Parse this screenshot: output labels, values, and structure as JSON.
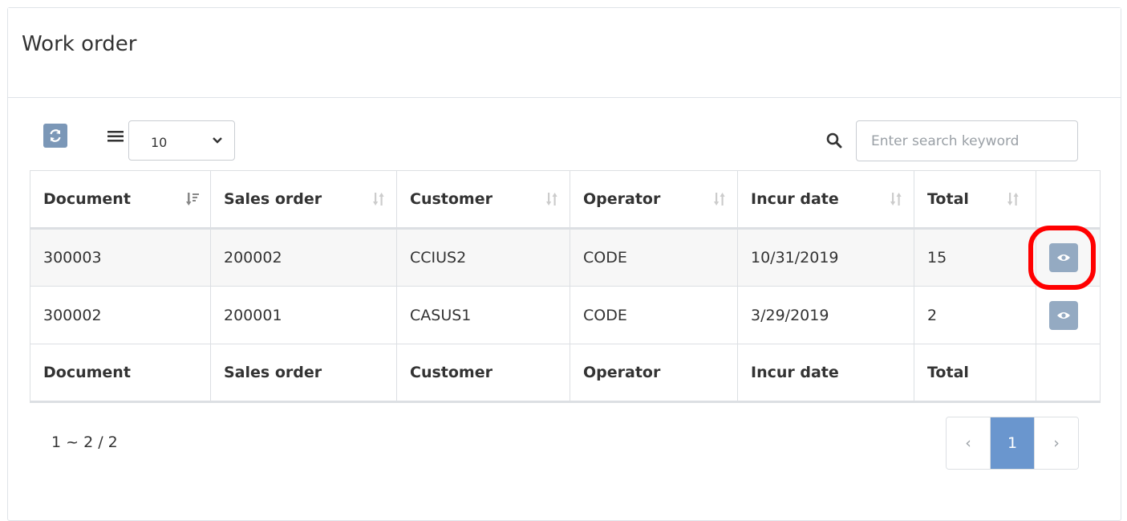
{
  "panel": {
    "title": "Work order"
  },
  "toolbar": {
    "refresh_icon": "refresh-icon",
    "menu_icon": "list-icon",
    "page_size": "10",
    "search_placeholder": "Enter search keyword",
    "search_icon": "search-icon"
  },
  "table": {
    "columns": [
      "Document",
      "Sales order",
      "Customer",
      "Operator",
      "Incur date",
      "Total"
    ],
    "rows": [
      {
        "document": "300003",
        "sales_order": "200002",
        "customer": "CCIUS2",
        "operator": "CODE",
        "incur_date": "10/31/2019",
        "total": "15"
      },
      {
        "document": "300002",
        "sales_order": "200001",
        "customer": "CASUS1",
        "operator": "CODE",
        "incur_date": "3/29/2019",
        "total": "2"
      }
    ],
    "footer": [
      "Document",
      "Sales order",
      "Customer",
      "Operator",
      "Incur date",
      "Total"
    ]
  },
  "pagination": {
    "range": "1 ~ 2 / 2",
    "prev": "‹",
    "current": "1",
    "next": "›"
  },
  "colors": {
    "accent": "#6a96ce",
    "button": "#7b97b7",
    "highlight": "#ff0000"
  }
}
